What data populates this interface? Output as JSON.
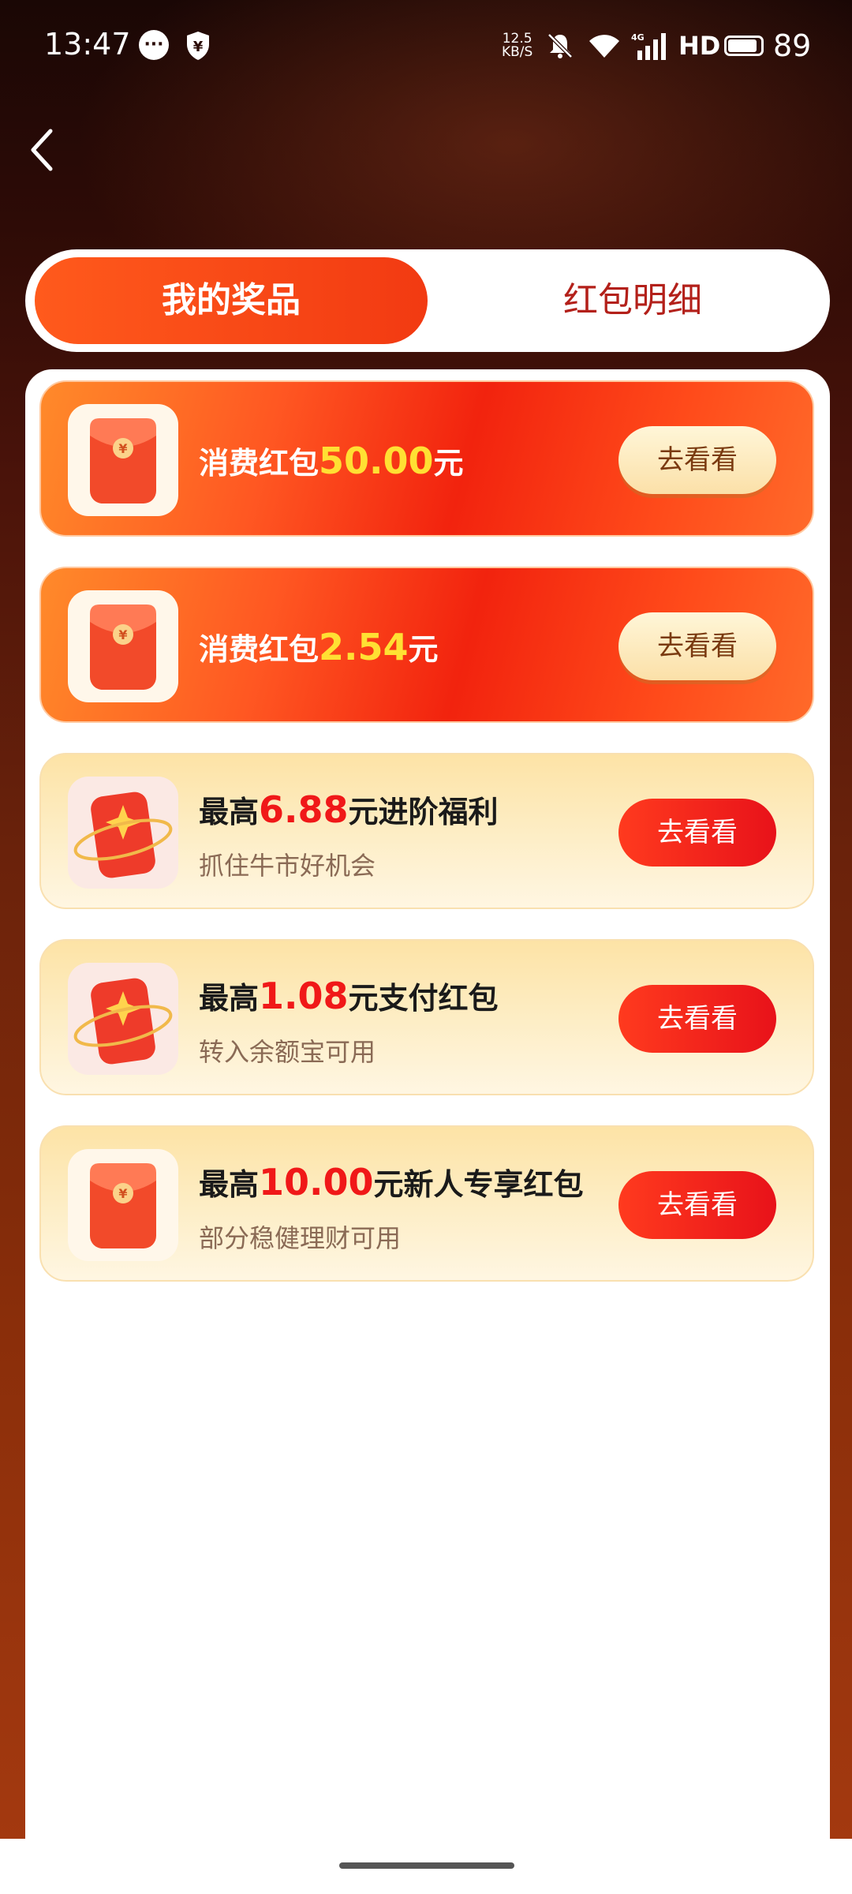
{
  "status_bar": {
    "time": "13:47",
    "net_speed_value": "12.5",
    "net_speed_unit": "KB/S",
    "network_label": "4G",
    "hd_label": "HD",
    "battery": "89",
    "battery_level": 0.89
  },
  "tabs": [
    {
      "label": "我的奖品",
      "active": true
    },
    {
      "label": "红包明细",
      "active": false
    }
  ],
  "rewards": [
    {
      "style": "red",
      "prefix": "消费红包",
      "amount": "50.00",
      "suffix": "元",
      "subtitle": "",
      "button": "去看看",
      "icon": "red-envelope-icon"
    },
    {
      "style": "red",
      "prefix": "消费红包",
      "amount": "2.54",
      "suffix": "元",
      "subtitle": "",
      "button": "去看看",
      "icon": "red-envelope-icon"
    },
    {
      "style": "cream",
      "prefix": "最高",
      "amount": "6.88",
      "suffix": "元进阶福利",
      "subtitle": "抓住牛市好机会",
      "button": "去看看",
      "icon": "red-envelope-star-ring-icon"
    },
    {
      "style": "cream",
      "prefix": "最高",
      "amount": "1.08",
      "suffix": "元支付红包",
      "subtitle": "转入余额宝可用",
      "button": "去看看",
      "icon": "red-envelope-star-ring-icon"
    },
    {
      "style": "cream",
      "prefix": "最高",
      "amount": "10.00",
      "suffix": "元新人专享红包",
      "subtitle": "部分稳健理财可用",
      "button": "去看看",
      "icon": "red-envelope-icon"
    }
  ],
  "colors": {
    "active_tab": "#f23a12",
    "inactive_tab_text": "#b3201a",
    "amount_highlight_red_card": "#ffe033",
    "amount_highlight_cream_card": "#f01818"
  }
}
